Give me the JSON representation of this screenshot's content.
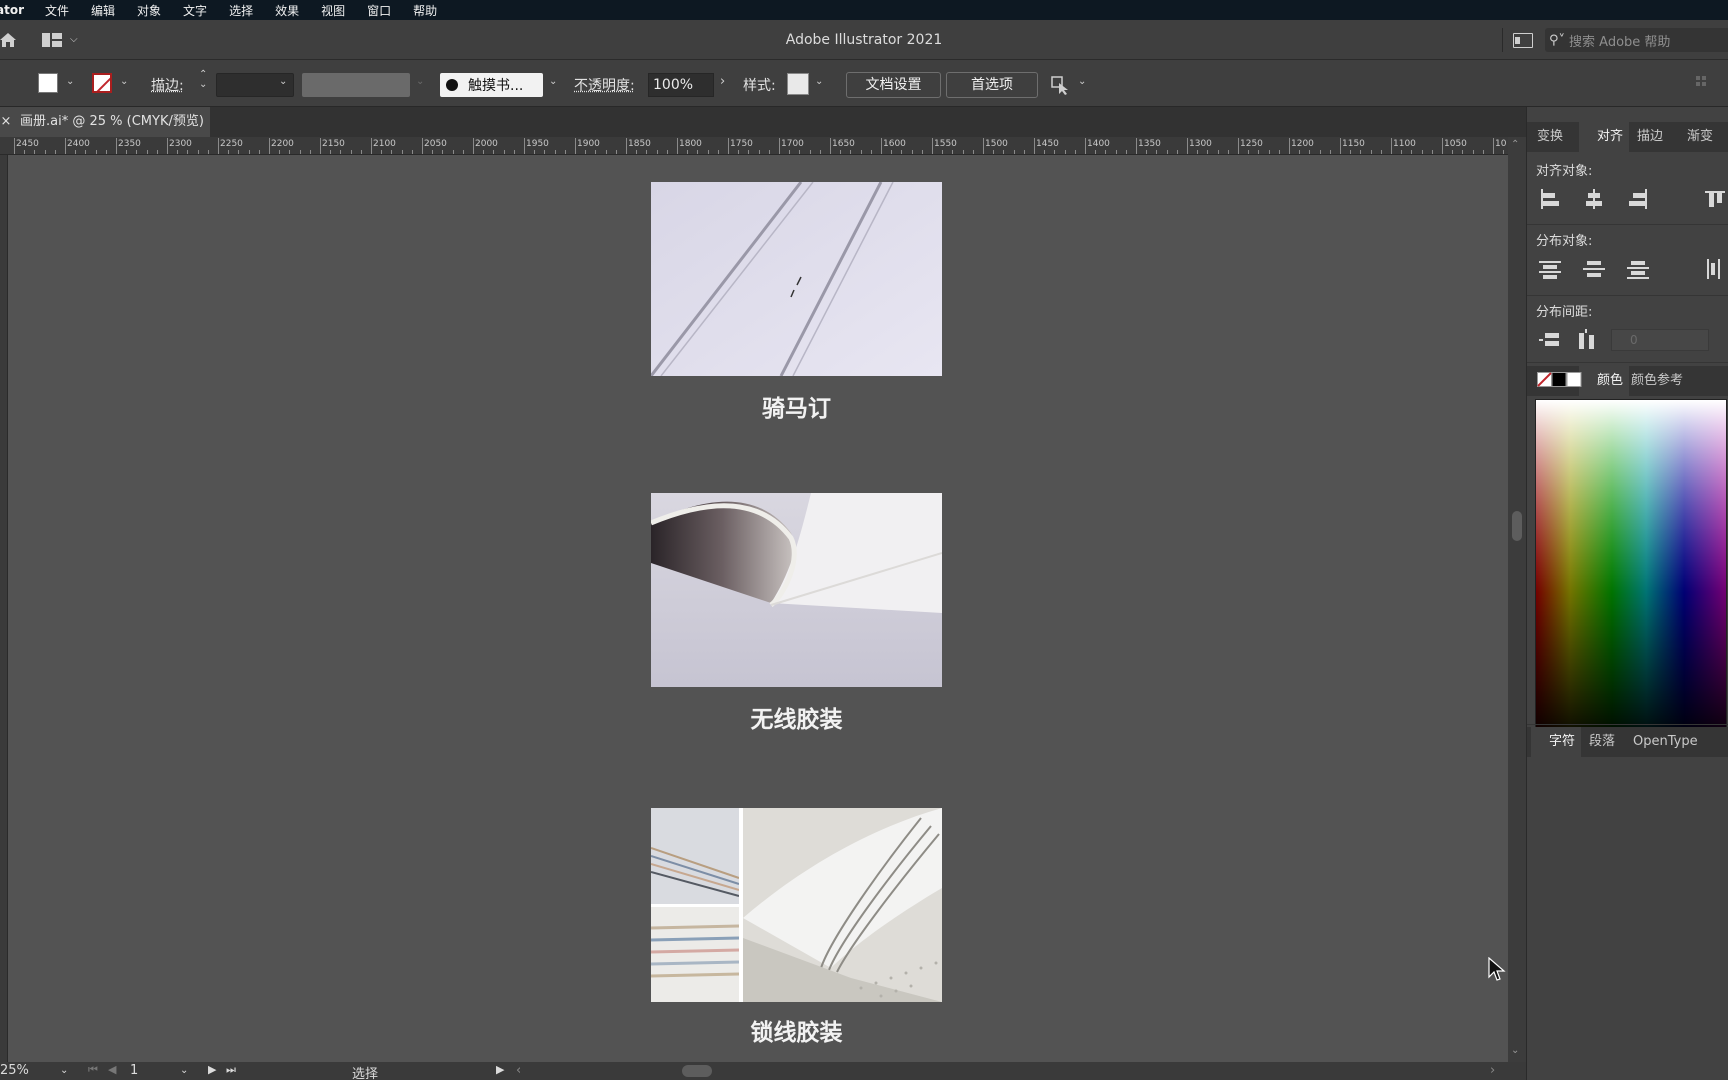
{
  "menubar": {
    "app_name": "ator",
    "items": [
      "文件",
      "编辑",
      "对象",
      "文字",
      "选择",
      "效果",
      "视图",
      "窗口",
      "帮助"
    ]
  },
  "titlebar": {
    "title": "Adobe Illustrator 2021",
    "search_placeholder": "搜索 Adobe 帮助"
  },
  "controlbar": {
    "stroke_label": "描边:",
    "brush_label": "触摸书...",
    "opacity_label": "不透明度:",
    "opacity_value": "100%",
    "style_label": "样式:",
    "doc_setup": "文档设置",
    "preferences": "首选项"
  },
  "document_tab": {
    "close": "×",
    "title": "画册.ai* @ 25 % (CMYK/预览)"
  },
  "ruler": {
    "labels": [
      "2450",
      "2400",
      "2350",
      "2300",
      "2250",
      "2200",
      "2150",
      "2100",
      "2050",
      "2000",
      "1950",
      "1900",
      "1850",
      "1800",
      "1750",
      "1700",
      "1650",
      "1600",
      "1550",
      "1500",
      "1450",
      "1400",
      "1350",
      "1300",
      "1250",
      "1200",
      "1150",
      "1100",
      "1050",
      "10"
    ]
  },
  "canvas": {
    "captions": [
      "骑马订",
      "无线胶装",
      "锁线胶装"
    ]
  },
  "statusbar": {
    "zoom": "25%",
    "page": "1",
    "tool": "选择"
  },
  "panel": {
    "tabs_top": [
      "变换",
      "对齐",
      "描边",
      "渐变"
    ],
    "align_objects": "对齐对象:",
    "distribute_objects": "分布对象:",
    "distribute_spacing": "分布间距:",
    "spacing_value": "0",
    "tabs_color": [
      "色板",
      "颜色",
      "颜色参考"
    ],
    "tabs_char": [
      "字符",
      "段落",
      "OpenType"
    ]
  }
}
